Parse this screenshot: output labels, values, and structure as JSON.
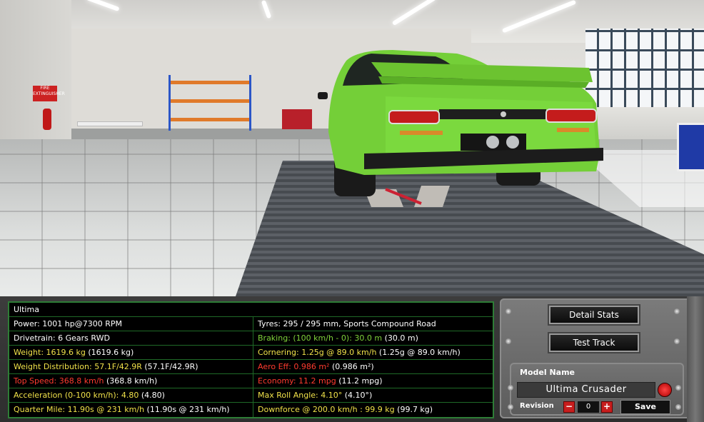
{
  "scene": {
    "fire_sign_text": "FIRE EXTINGUISHER",
    "car_color": "#74cf38"
  },
  "stats": {
    "title": "Ultima",
    "rows": [
      {
        "left": {
          "label": "Power: 1001 hp@7300 RPM",
          "value": ""
        },
        "right": {
          "label": "Tyres: 295 / 295 mm, Sports Compound Road",
          "value": ""
        }
      },
      {
        "left": {
          "label": "Drivetrain: 6 Gears RWD",
          "value": ""
        },
        "right": {
          "label": "Braking: (100 km/h - 0): 30.0 m",
          "value": " (30.0 m)"
        }
      },
      {
        "left": {
          "label": "Weight: 1619.6 kg",
          "value": " (1619.6 kg)"
        },
        "right": {
          "label": "Cornering: 1.25g @ 89.0 km/h",
          "value": " (1.25g @ 89.0 km/h)"
        }
      },
      {
        "left": {
          "label": "Weight Distribution: 57.1F/42.9R",
          "value": " (57.1F/42.9R)"
        },
        "right": {
          "label": "Aero Eff: 0.986 m²",
          "value": " (0.986 m²)"
        }
      },
      {
        "left": {
          "label": "Top Speed: 368.8 km/h",
          "value": " (368.8 km/h)"
        },
        "right": {
          "label": "Economy: 11.2 mpg",
          "value": " (11.2 mpg)"
        }
      },
      {
        "left": {
          "label": "Acceleration (0-100 km/h): 4.80",
          "value": " (4.80)"
        },
        "right": {
          "label": "Max Roll Angle: 4.10°",
          "value": " (4.10°)"
        }
      },
      {
        "left": {
          "label": "Quarter Mile: 11.90s @ 231 km/h",
          "value": " (11.90s @ 231 km/h)"
        },
        "right": {
          "label": "Downforce @ 200.0 km/h : 99.9 kg",
          "value": " (99.7 kg)"
        }
      }
    ]
  },
  "controls": {
    "detail_stats_label": "Detail Stats",
    "test_track_label": "Test Track",
    "model_name_label": "Model Name",
    "model_name_value": "Ultima Crusader",
    "revision_label": "Revision",
    "revision_minus": "−",
    "revision_value": "0",
    "revision_plus": "+",
    "save_label": "Save"
  }
}
